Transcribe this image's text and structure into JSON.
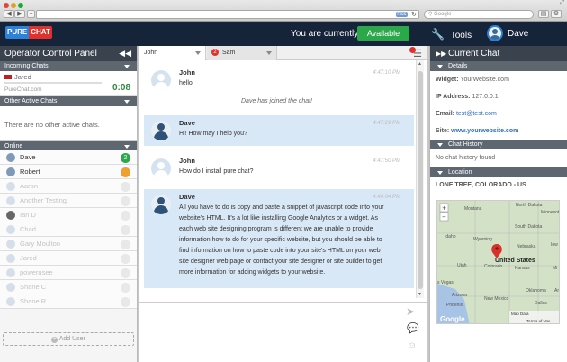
{
  "browser": {
    "search_placeholder": "Google"
  },
  "topbar": {
    "logo_part1": "PURE",
    "logo_part2": "CHAT",
    "status_text": "You are currently",
    "status_button": "Available",
    "tools_label": "Tools",
    "user_name": "Dave"
  },
  "left": {
    "panel_title": "Operator Control Panel",
    "incoming_header": "Incoming Chats",
    "incoming_visitor": "Jared",
    "incoming_site": "PureChat.com",
    "incoming_timer": "0:08",
    "other_header": "Other Active Chats",
    "other_empty": "There are no other active chats.",
    "online_header": "Online",
    "operators": [
      {
        "name": "Dave",
        "badge": "2",
        "dim": false
      },
      {
        "name": "Robert",
        "badge": "",
        "dim": false
      },
      {
        "name": "Aaron",
        "badge": "",
        "dim": true
      },
      {
        "name": "Another Testing",
        "badge": "",
        "dim": true
      },
      {
        "name": "Ian D",
        "badge": "",
        "dim": true
      },
      {
        "name": "Chad",
        "badge": "",
        "dim": true
      },
      {
        "name": "Gary Moulton",
        "badge": "",
        "dim": true
      },
      {
        "name": "Jared",
        "badge": "",
        "dim": true
      },
      {
        "name": "powerusee",
        "badge": "",
        "dim": true
      },
      {
        "name": "Shane C",
        "badge": "",
        "dim": true
      },
      {
        "name": "Shane R",
        "badge": "",
        "dim": true
      }
    ],
    "add_user": "Add User"
  },
  "tabs": [
    {
      "label": "John"
    },
    {
      "label": "Sam",
      "badge": "2"
    }
  ],
  "messages": [
    {
      "name": "John",
      "time": "4:47:10 PM",
      "text": "hello"
    },
    {
      "system": "Dave has joined the chat!"
    },
    {
      "name": "Dave",
      "time": "4:47:29 PM",
      "text": "Hi! How may I help you?"
    },
    {
      "name": "John",
      "time": "4:47:50 PM",
      "text": "How do I install pure chat?"
    },
    {
      "name": "Dave",
      "time": "4:49:04 PM",
      "lines": [
        "All you have to do is copy and paste a snippet of javascript code into your",
        "website's HTML. It's a lot like installing Google Analytics or a widget. As",
        "each web site designing program is different we are unable to provide",
        "information how to do for your specific website, but you should be able to",
        "find information on how to paste code into your site's HTML on your web",
        "site designer web page or contact your site designer or site builder to get",
        "more information for adding widgets to your website."
      ]
    }
  ],
  "right": {
    "title": "Current Chat",
    "details_header": "Details",
    "widget_label": "Widget:",
    "widget_value": "YourWebsite.com",
    "ip_label": "IP Address:",
    "ip_value": "127.0.0.1",
    "email_label": "Email:",
    "email_value": "test@test.com",
    "site_label": "Site:",
    "site_value": "www.yourwebsite.com",
    "history_header": "Chat History",
    "history_empty": "No chat history found",
    "location_header": "Location",
    "location_value": "LONE TREE, COLORADO - US",
    "map": {
      "label_north_dakota": "North Dakota",
      "label_montana": "Montana",
      "label_minnesota": "Minnesot",
      "label_south_dakota": "South Dakota",
      "label_idaho": "Idaho",
      "label_wyoming": "Wyoming",
      "label_nebraska": "Nebraska",
      "label_iowa": "Iow",
      "label_utah": "Utah",
      "label_colorado": "Colorado",
      "label_united_states": "United States",
      "label_kansas": "Kansas",
      "label_mi": "Mi",
      "label_las_vegas": "s Vegas",
      "label_oklahoma": "Oklahoma",
      "label_ar": "Ar",
      "label_arizona": "Arizona",
      "label_phoenix": "Phoenix",
      "label_new_mexico": "New Mexico",
      "label_dallas": "Dallas",
      "label_google": "Google",
      "label_map_data": "Map Data",
      "label_terms": "Terms of Use",
      "zoom_in": "+",
      "zoom_out": "−"
    }
  }
}
